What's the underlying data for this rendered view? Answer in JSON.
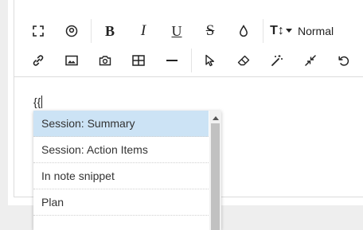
{
  "toolbar": {
    "bold_label": "B",
    "italic_label": "I",
    "underline_label": "U",
    "strike_label": "S",
    "text_size_label": "T↕",
    "heading_value": "Normal"
  },
  "editor": {
    "typed_text": "{{"
  },
  "autocomplete": {
    "items": [
      {
        "label": "Session: Summary"
      },
      {
        "label": "Session: Action Items"
      },
      {
        "label": "In note snippet"
      },
      {
        "label": "Plan"
      }
    ]
  }
}
